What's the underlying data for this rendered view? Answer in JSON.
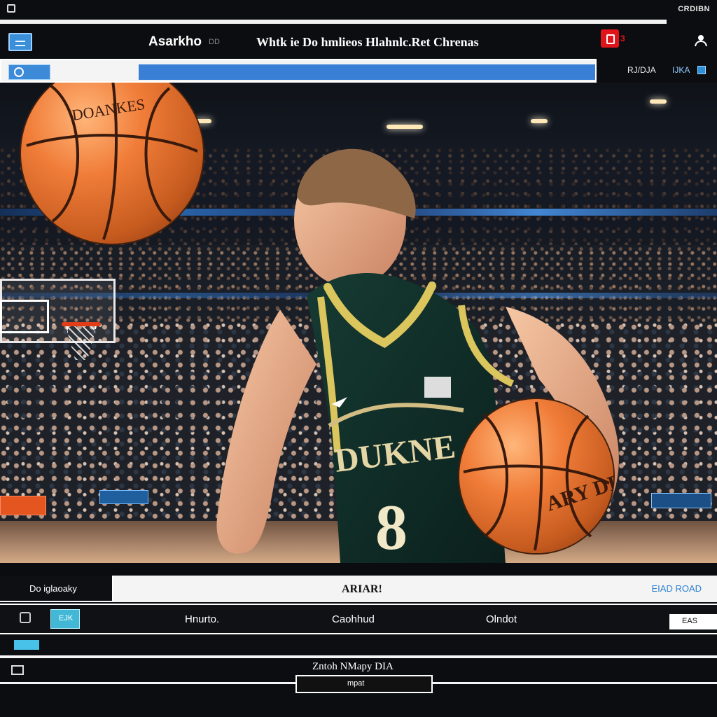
{
  "window": {
    "system_label": "CRDIBN"
  },
  "header": {
    "app_title": "Asarkho",
    "app_badge": "DD",
    "page_title": "Whtk ie Do hmlieos Hlahnlc.Ret Chrenas",
    "alert_count": "3"
  },
  "search": {
    "right_label_a": "RJ/DJA",
    "right_label_b": "IJKA"
  },
  "scene": {
    "ball_top_text": "DOANKES",
    "jersey_text": "DUKNE",
    "jersey_number": "8",
    "ball_hand_text": "ARY DIE"
  },
  "bottom": {
    "info_left": "Do iglaoaky",
    "info_center": "ARIAR!",
    "info_right": "EIAD ROAD",
    "tabs": [
      {
        "label": "Hnurto."
      },
      {
        "label": "Caohhud"
      },
      {
        "label": "Olndot"
      }
    ],
    "tab_box_label": "EJK",
    "tab_right_label": "EAS",
    "footer_caption": "Zntoh NMapy DIA",
    "footer_button_label": "mpat"
  },
  "colors": {
    "accent": "#3a7fd6",
    "alert": "#e1141b",
    "cyan": "#49c2ea",
    "background": "#0c0d10"
  },
  "icons": {
    "menu": "menu-icon",
    "alert": "shield-icon",
    "profile": "person-icon",
    "search": "search-icon"
  }
}
